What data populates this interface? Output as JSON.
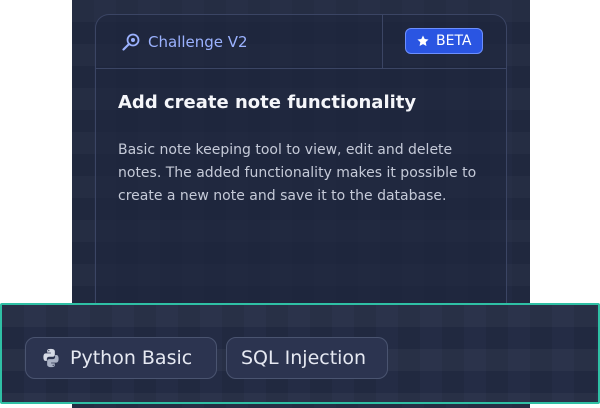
{
  "card": {
    "challenge_label": "Challenge V2",
    "challenge_icon": "challenge-icon",
    "badge_label": "BETA",
    "badge_icon": "star-icon",
    "title": "Add create note functionality",
    "description": "Basic note keeping tool to view, edit and delete notes. The added functionality makes it possible to create a new note and save it to the database."
  },
  "tags": [
    {
      "label": "Python Basic",
      "icon": "python-icon"
    },
    {
      "label": "SQL Injection"
    }
  ],
  "colors": {
    "panel_bg": "#222a42",
    "accent_blue": "#9bb2ff",
    "badge_bg": "#2a55e2",
    "highlight_border": "#2fc0a5"
  }
}
